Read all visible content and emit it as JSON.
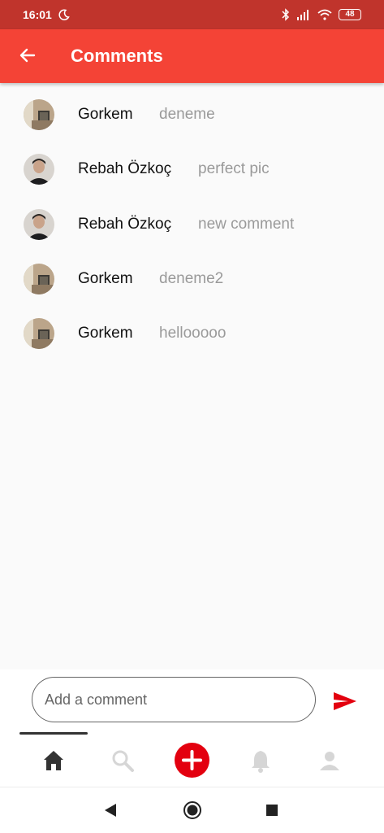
{
  "status_bar": {
    "time": "16:01",
    "battery": "48"
  },
  "header": {
    "title": "Comments"
  },
  "comments": [
    {
      "user": "Gorkem",
      "text": "deneme",
      "avatar": "room-photo"
    },
    {
      "user": "Rebah Özkoç",
      "text": "perfect pic",
      "avatar": "person-photo"
    },
    {
      "user": "Rebah Özkoç",
      "text": "new comment",
      "avatar": "person-photo"
    },
    {
      "user": "Gorkem",
      "text": "deneme2",
      "avatar": "room-photo"
    },
    {
      "user": "Gorkem",
      "text": "hellooooo",
      "avatar": "room-photo"
    }
  ],
  "input": {
    "placeholder": "Add a comment",
    "value": ""
  },
  "bottom_nav": {
    "items": [
      "home-icon",
      "search-icon",
      "add-icon",
      "bell-icon",
      "person-icon"
    ],
    "active": "home-icon"
  },
  "colors": {
    "status": "#c0342c",
    "appbar": "#f44336",
    "accent": "#e3000f",
    "muted_text": "#9a9a9a"
  }
}
